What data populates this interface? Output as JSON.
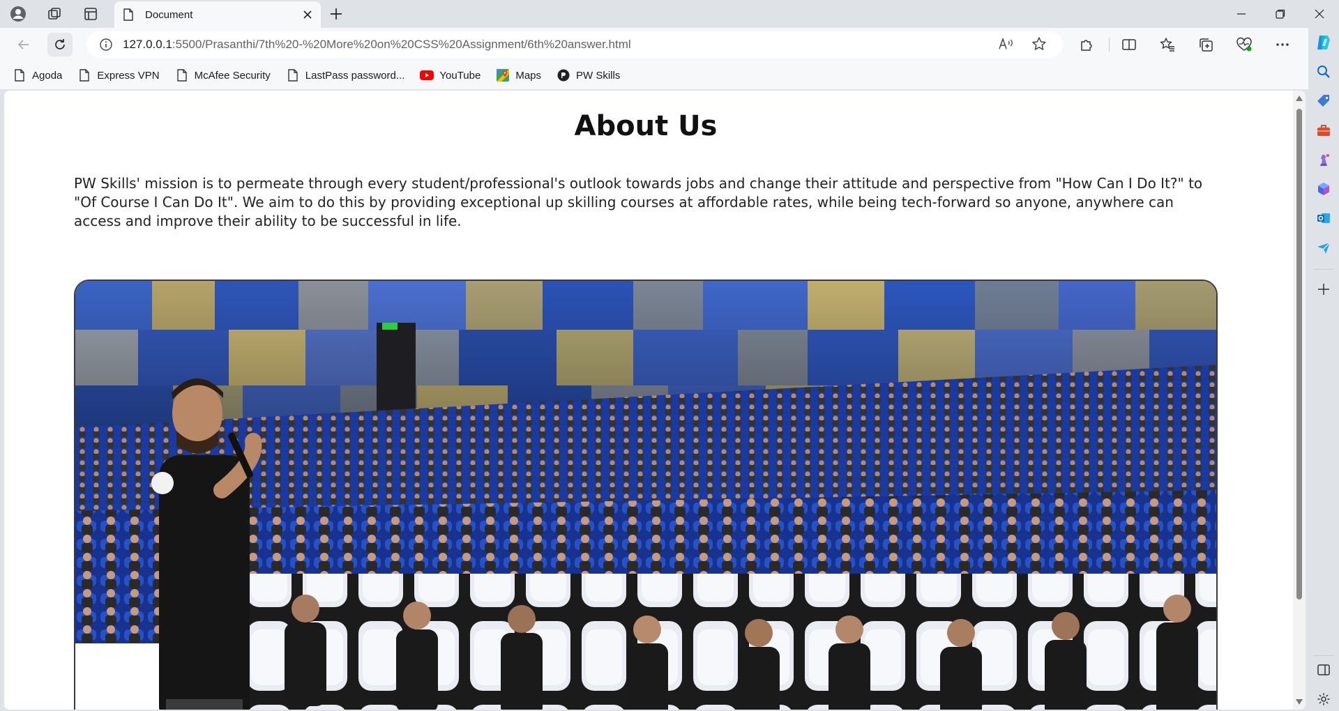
{
  "browser": {
    "tab_title": "Document",
    "url_host": "127.0.0.1",
    "url_path": ":5500/Prasanthi/7th%20-%20More%20on%20CSS%20Assignment/6th%20answer.html"
  },
  "bookmarks": [
    {
      "label": "Agoda",
      "icon": "page-icon"
    },
    {
      "label": "Express VPN",
      "icon": "page-icon"
    },
    {
      "label": "McAfee Security",
      "icon": "page-icon"
    },
    {
      "label": "LastPass password...",
      "icon": "page-icon"
    },
    {
      "label": "YouTube",
      "icon": "youtube-icon"
    },
    {
      "label": "Maps",
      "icon": "maps-icon"
    },
    {
      "label": "PW Skills",
      "icon": "pw-skills-icon"
    }
  ],
  "page": {
    "heading": "About Us",
    "mission": "PW Skills' mission is to permeate through every student/professional's outlook towards jobs and change their attitude and perspective from \"How Can I Do It?\" to \"Of Course I Can Do It\". We aim to do this by providing exceptional up skilling courses at affordable rates, while being tech-forward so anyone, anywhere can access and improve their ability to be successful in life."
  },
  "colors": {
    "accent": "#0f6cbd",
    "seat_blue": "#1e44b4",
    "shirt_black": "#1a1a1a"
  }
}
